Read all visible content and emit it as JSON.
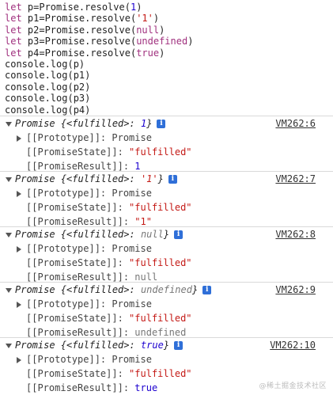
{
  "code": [
    {
      "kw": "let",
      "rest_a": " p=Promise.resolve(",
      "arg": "1",
      "arg_type": "num",
      "rest_b": ")"
    },
    {
      "kw": "let",
      "rest_a": " p1=Promise.resolve(",
      "arg": "'1'",
      "arg_type": "str",
      "rest_b": ")"
    },
    {
      "kw": "let",
      "rest_a": " p2=Promise.resolve(",
      "arg": "null",
      "arg_type": "kw",
      "rest_b": ")"
    },
    {
      "kw": "let",
      "rest_a": " p3=Promise.resolve(",
      "arg": "undefined",
      "arg_type": "kw",
      "rest_b": ")"
    },
    {
      "kw": "let",
      "rest_a": " p4=Promise.resolve(",
      "arg": "true",
      "arg_type": "kw",
      "rest_b": ")"
    },
    {
      "plain": "console.log(p)"
    },
    {
      "plain": "console.log(p1)"
    },
    {
      "plain": "console.log(p2)"
    },
    {
      "plain": "console.log(p3)"
    },
    {
      "plain": "console.log(p4)"
    }
  ],
  "entries": [
    {
      "head_prefix": "Promise {<fulfilled>: ",
      "head_value": "1",
      "head_suffix": "}",
      "source": "VM262:6",
      "prototype_label": "[[Prototype]]: Promise",
      "state_label": "[[PromiseState]]: ",
      "state_value": "\"fulfilled\"",
      "result_label": "[[PromiseResult]]: ",
      "result_value": "1"
    },
    {
      "head_prefix": "Promise {<fulfilled>: ",
      "head_value": "'1'",
      "head_suffix": "}",
      "source": "VM262:7",
      "prototype_label": "[[Prototype]]: Promise",
      "state_label": "[[PromiseState]]: ",
      "state_value": "\"fulfilled\"",
      "result_label": "[[PromiseResult]]: ",
      "result_value": "\"1\""
    },
    {
      "head_prefix": "Promise {<fulfilled>: ",
      "head_value": "null",
      "head_suffix": "}",
      "source": "VM262:8",
      "prototype_label": "[[Prototype]]: Promise",
      "state_label": "[[PromiseState]]: ",
      "state_value": "\"fulfilled\"",
      "result_label": "[[PromiseResult]]: ",
      "result_value": "null"
    },
    {
      "head_prefix": "Promise {<fulfilled>: ",
      "head_value": "undefined",
      "head_suffix": "}",
      "source": "VM262:9",
      "prototype_label": "[[Prototype]]: Promise",
      "state_label": "[[PromiseState]]: ",
      "state_value": "\"fulfilled\"",
      "result_label": "[[PromiseResult]]: ",
      "result_value": "undefined"
    },
    {
      "head_prefix": "Promise {<fulfilled>: ",
      "head_value": "true",
      "head_suffix": "}",
      "source": "VM262:10",
      "prototype_label": "[[Prototype]]: Promise",
      "state_label": "[[PromiseState]]: ",
      "state_value": "\"fulfilled\"",
      "result_label": "[[PromiseResult]]: ",
      "result_value": "true"
    }
  ],
  "info_icon_glyph": "i",
  "watermark": "@稀土掘金技术社区"
}
